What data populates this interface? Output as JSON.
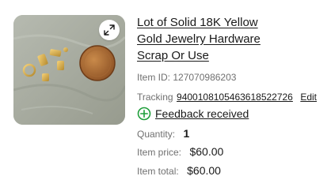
{
  "item": {
    "title": "Lot of Solid 18K Yellow Gold Jewelry Hardware Scrap Or Use",
    "image_alt": "Gold jewelry hardware pieces next to a penny",
    "expand_icon": "expand-icon"
  },
  "item_id": {
    "label": "Item ID:",
    "value": "127070986203"
  },
  "tracking": {
    "label": "Tracking",
    "number": "9400108105463618522726",
    "edit_label": "Edit"
  },
  "feedback": {
    "icon": "plus-circle-icon",
    "label": "Feedback received",
    "color": "#1e9e3a"
  },
  "quantity": {
    "label": "Quantity:",
    "value": "1"
  },
  "item_price": {
    "label": "Item price:",
    "value": "$60.00"
  },
  "item_total": {
    "label": "Item total:",
    "value": "$60.00"
  }
}
